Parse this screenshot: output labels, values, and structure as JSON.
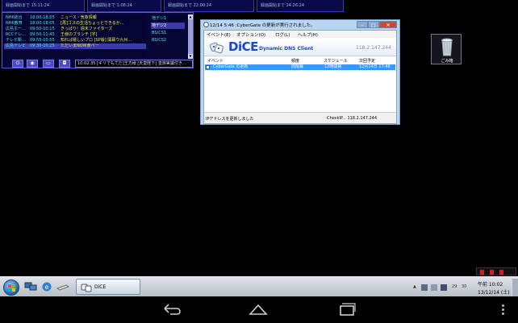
{
  "timers": [
    {
      "label": "録画開始まで 15:11:24"
    },
    {
      "label": "録画開始まで 1:08:24"
    },
    {
      "label": "録画開始まで 22:00:24"
    },
    {
      "label": "録画開始まで 24:26:24"
    }
  ],
  "tvguide": {
    "programs": [
      {
        "channel": "NHK総合",
        "time": "18:00-18:05",
        "title": "ニュース・気象情報"
      },
      {
        "channel": "NHK教育",
        "time": "18:00-18:05",
        "title": "[再]ゴスの生活ちょっとできるか…"
      },
      {
        "channel": "広島ホー…",
        "time": "09:50-10:15",
        "title": "きっぱり！週末ファイターズ"
      },
      {
        "channel": "RCCテレ…",
        "time": "09:50-11:45",
        "title": "王様のブランチ [字]"
      },
      {
        "channel": "テレビ新…",
        "time": "09:55-10:55",
        "title": "知れば嬉しいプロ [SP版] 開幕ウ九州…"
      },
      {
        "channel": "広島テレビ",
        "time": "09:30-10:25",
        "title": "ただいまNOW食べー"
      }
    ],
    "channels": [
      "地デジ1",
      "地デジ2",
      "BS/CS1",
      "BS/CS2"
    ],
    "selected_channel_index": 1,
    "ticker": "10:02:35 [ギリでもてだ]王方様 [天皇陛下] 皇族実議付き…"
  },
  "desktop": {
    "recycle_bin_label": "ごみ箱"
  },
  "dice": {
    "window_title": "12/14 5:46 :CyberGate の更新が実行されました。",
    "menu": [
      "イベント(E)",
      "オプション(O)",
      "ログ(L)",
      "ヘルプ(H)"
    ],
    "logo": "DiCE",
    "subtitle": "Dynamic DNS Client",
    "ip": "118.2.147.244",
    "columns": [
      "イベント",
      "頻度",
      "スケジュール",
      "次回予定"
    ],
    "rows": [
      {
        "event": "CyberGate の更新",
        "frequency": "間隔毎",
        "schedule": "12時間毎",
        "next": "12月14日 17:46",
        "checked": true
      }
    ],
    "status_left": "IPアドレスを更新しました",
    "status_right": "CheckIP... 118.2.147.244"
  },
  "taskbar": {
    "task_label": "DiCE",
    "tray_numbers": [
      "29",
      "30"
    ],
    "clock_time": "午前 10:02",
    "clock_date": "13/12/14 (土)"
  },
  "colors": {
    "accent": "#3399ff",
    "dice_blue": "#1b48c8",
    "tv_bg": "#06063a"
  }
}
